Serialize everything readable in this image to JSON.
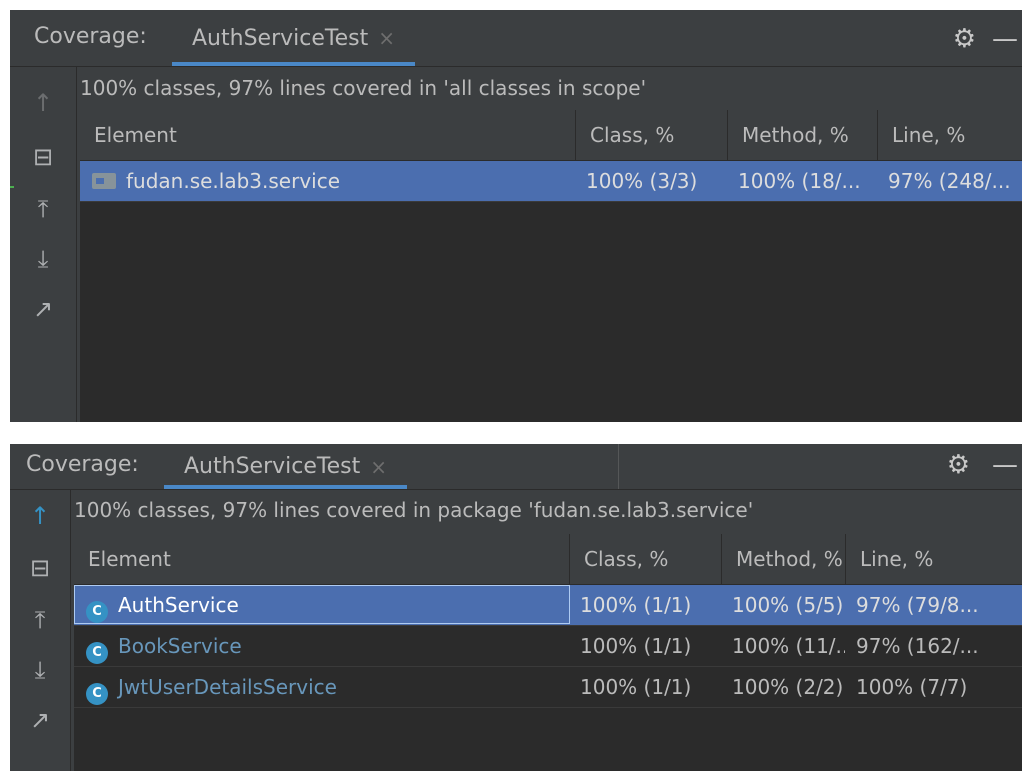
{
  "panels": [
    {
      "header": {
        "title": "Coverage:",
        "tab_label": "AuthServiceTest",
        "tab_close": "×",
        "gear": "⚙",
        "minimize": "—"
      },
      "toolbar": [
        "↑",
        "⊟",
        "⤒",
        "⤓",
        "↗"
      ],
      "summary": "100% classes, 97% lines covered in 'all classes in scope'",
      "columns": [
        "Element",
        "Class, %",
        "Method, %",
        "Line, %"
      ],
      "rows": [
        {
          "name": "fudan.se.lab3.service",
          "class": "100% (3/3)",
          "method": "100% (18/...",
          "line": "97% (248/..."
        }
      ]
    },
    {
      "header": {
        "title": "Coverage:",
        "tab_label": "AuthServiceTest",
        "tab_close": "×",
        "gear": "⚙",
        "minimize": "—"
      },
      "toolbar": [
        "↑",
        "⊟",
        "⤒",
        "⤓",
        "↗"
      ],
      "summary": "100% classes, 97% lines covered in package 'fudan.se.lab3.service'",
      "columns": [
        "Element",
        "Class, %",
        "Method, %",
        "Line, %"
      ],
      "rows": [
        {
          "name": "AuthService",
          "class": "100% (1/1)",
          "method": "100% (5/5)",
          "line": "97% (79/8..."
        },
        {
          "name": "BookService",
          "class": "100% (1/1)",
          "method": "100% (11/...",
          "line": "97% (162/..."
        },
        {
          "name": "JwtUserDetailsService",
          "class": "100% (1/1)",
          "method": "100% (2/2)",
          "line": "100% (7/7)"
        }
      ]
    }
  ],
  "icons": {
    "folder": "package-folder-icon",
    "class": "C"
  }
}
